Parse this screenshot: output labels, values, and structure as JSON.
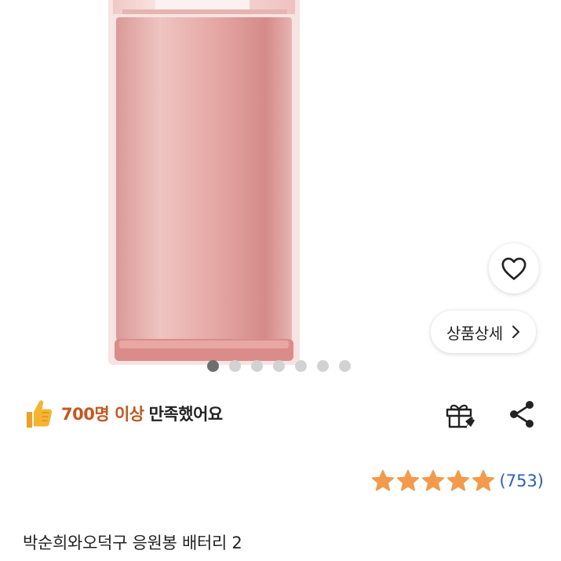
{
  "gallery": {
    "slide_count": 7,
    "active_slide": 1,
    "detail_button_label": "상품상세"
  },
  "satisfaction": {
    "count": "700명 이상",
    "suffix": "만족했어요"
  },
  "rating": {
    "stars": 5,
    "review_count": "(753)",
    "star_color": "#f59a4a"
  },
  "product": {
    "title": "박순희와오덕구 응원봉 배터리 2"
  },
  "icons": {
    "wish": "heart-outline-icon",
    "chevron": "chevron-right-icon",
    "thumb": "thumbs-up-icon",
    "gift": "gift-icon",
    "share": "share-icon"
  },
  "colors": {
    "satisfaction_accent": "#c8561c",
    "review_link": "#2b5fc7",
    "product_pink": "#e8a8a4"
  }
}
